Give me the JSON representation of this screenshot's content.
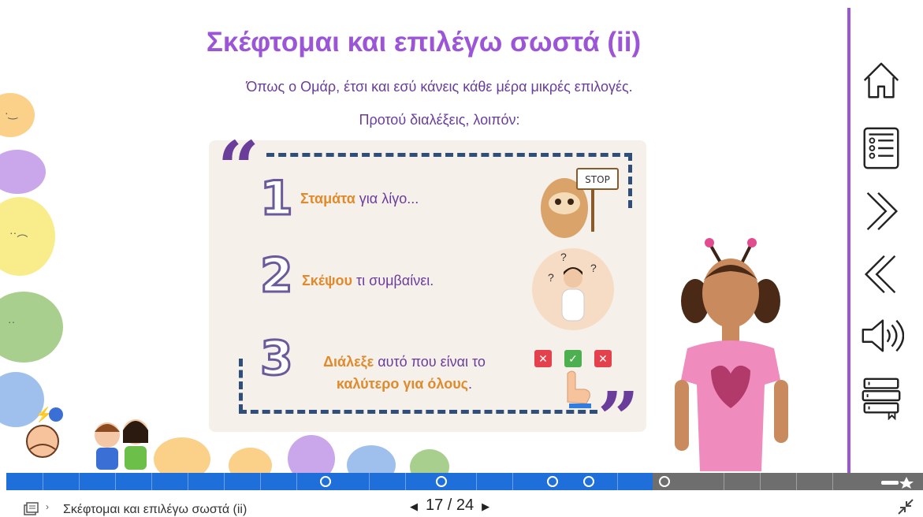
{
  "title": "Σκέφτομαι και επιλέγω σωστά (ii)",
  "intro_line1": "Όπως ο Ομάρ, έτσι και εσύ κάνεις κάθε μέρα μικρές επιλογές.",
  "intro_line2": "Προτού διαλέξεις, λοιπόν:",
  "steps": [
    {
      "number": "1",
      "highlight": "Σταμάτα",
      "rest": " για λίγο..."
    },
    {
      "number": "2",
      "highlight": "Σκέψου",
      "rest": " τι συμβαίνει."
    },
    {
      "number": "3",
      "highlight": "Διάλεξε",
      "rest": " αυτό που είναι το",
      "highlight2": "καλύτερο για όλους",
      "rest2": "."
    }
  ],
  "stop_sign": "STOP",
  "nav": {
    "icons": [
      "home-icon",
      "menu-list-icon",
      "next-icon",
      "previous-icon",
      "audio-icon",
      "library-icon"
    ]
  },
  "footer": {
    "slide_title": "Σκέφτομαι και επιλέγω σωστά (ii)",
    "page_current": "17",
    "page_sep": " / ",
    "page_total": "24"
  },
  "colors": {
    "accent_purple": "#9b55d6",
    "text_purple": "#6a3d9a",
    "highlight_orange": "#e08a2c",
    "progress_blue": "#1e6fd9"
  }
}
